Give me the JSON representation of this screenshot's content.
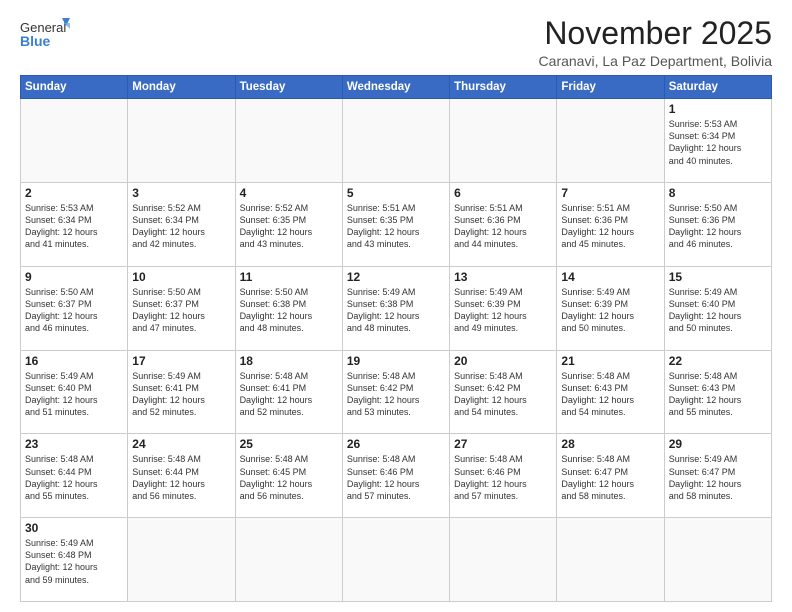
{
  "header": {
    "logo_general": "General",
    "logo_blue": "Blue",
    "title": "November 2025",
    "subtitle": "Caranavi, La Paz Department, Bolivia"
  },
  "weekdays": [
    "Sunday",
    "Monday",
    "Tuesday",
    "Wednesday",
    "Thursday",
    "Friday",
    "Saturday"
  ],
  "weeks": [
    [
      {
        "day": "",
        "text": ""
      },
      {
        "day": "",
        "text": ""
      },
      {
        "day": "",
        "text": ""
      },
      {
        "day": "",
        "text": ""
      },
      {
        "day": "",
        "text": ""
      },
      {
        "day": "",
        "text": ""
      },
      {
        "day": "1",
        "text": "Sunrise: 5:53 AM\nSunset: 6:34 PM\nDaylight: 12 hours\nand 40 minutes."
      }
    ],
    [
      {
        "day": "2",
        "text": "Sunrise: 5:53 AM\nSunset: 6:34 PM\nDaylight: 12 hours\nand 41 minutes."
      },
      {
        "day": "3",
        "text": "Sunrise: 5:52 AM\nSunset: 6:34 PM\nDaylight: 12 hours\nand 42 minutes."
      },
      {
        "day": "4",
        "text": "Sunrise: 5:52 AM\nSunset: 6:35 PM\nDaylight: 12 hours\nand 43 minutes."
      },
      {
        "day": "5",
        "text": "Sunrise: 5:51 AM\nSunset: 6:35 PM\nDaylight: 12 hours\nand 43 minutes."
      },
      {
        "day": "6",
        "text": "Sunrise: 5:51 AM\nSunset: 6:36 PM\nDaylight: 12 hours\nand 44 minutes."
      },
      {
        "day": "7",
        "text": "Sunrise: 5:51 AM\nSunset: 6:36 PM\nDaylight: 12 hours\nand 45 minutes."
      },
      {
        "day": "8",
        "text": "Sunrise: 5:50 AM\nSunset: 6:36 PM\nDaylight: 12 hours\nand 46 minutes."
      }
    ],
    [
      {
        "day": "9",
        "text": "Sunrise: 5:50 AM\nSunset: 6:37 PM\nDaylight: 12 hours\nand 46 minutes."
      },
      {
        "day": "10",
        "text": "Sunrise: 5:50 AM\nSunset: 6:37 PM\nDaylight: 12 hours\nand 47 minutes."
      },
      {
        "day": "11",
        "text": "Sunrise: 5:50 AM\nSunset: 6:38 PM\nDaylight: 12 hours\nand 48 minutes."
      },
      {
        "day": "12",
        "text": "Sunrise: 5:49 AM\nSunset: 6:38 PM\nDaylight: 12 hours\nand 48 minutes."
      },
      {
        "day": "13",
        "text": "Sunrise: 5:49 AM\nSunset: 6:39 PM\nDaylight: 12 hours\nand 49 minutes."
      },
      {
        "day": "14",
        "text": "Sunrise: 5:49 AM\nSunset: 6:39 PM\nDaylight: 12 hours\nand 50 minutes."
      },
      {
        "day": "15",
        "text": "Sunrise: 5:49 AM\nSunset: 6:40 PM\nDaylight: 12 hours\nand 50 minutes."
      }
    ],
    [
      {
        "day": "16",
        "text": "Sunrise: 5:49 AM\nSunset: 6:40 PM\nDaylight: 12 hours\nand 51 minutes."
      },
      {
        "day": "17",
        "text": "Sunrise: 5:49 AM\nSunset: 6:41 PM\nDaylight: 12 hours\nand 52 minutes."
      },
      {
        "day": "18",
        "text": "Sunrise: 5:48 AM\nSunset: 6:41 PM\nDaylight: 12 hours\nand 52 minutes."
      },
      {
        "day": "19",
        "text": "Sunrise: 5:48 AM\nSunset: 6:42 PM\nDaylight: 12 hours\nand 53 minutes."
      },
      {
        "day": "20",
        "text": "Sunrise: 5:48 AM\nSunset: 6:42 PM\nDaylight: 12 hours\nand 54 minutes."
      },
      {
        "day": "21",
        "text": "Sunrise: 5:48 AM\nSunset: 6:43 PM\nDaylight: 12 hours\nand 54 minutes."
      },
      {
        "day": "22",
        "text": "Sunrise: 5:48 AM\nSunset: 6:43 PM\nDaylight: 12 hours\nand 55 minutes."
      }
    ],
    [
      {
        "day": "23",
        "text": "Sunrise: 5:48 AM\nSunset: 6:44 PM\nDaylight: 12 hours\nand 55 minutes."
      },
      {
        "day": "24",
        "text": "Sunrise: 5:48 AM\nSunset: 6:44 PM\nDaylight: 12 hours\nand 56 minutes."
      },
      {
        "day": "25",
        "text": "Sunrise: 5:48 AM\nSunset: 6:45 PM\nDaylight: 12 hours\nand 56 minutes."
      },
      {
        "day": "26",
        "text": "Sunrise: 5:48 AM\nSunset: 6:46 PM\nDaylight: 12 hours\nand 57 minutes."
      },
      {
        "day": "27",
        "text": "Sunrise: 5:48 AM\nSunset: 6:46 PM\nDaylight: 12 hours\nand 57 minutes."
      },
      {
        "day": "28",
        "text": "Sunrise: 5:48 AM\nSunset: 6:47 PM\nDaylight: 12 hours\nand 58 minutes."
      },
      {
        "day": "29",
        "text": "Sunrise: 5:49 AM\nSunset: 6:47 PM\nDaylight: 12 hours\nand 58 minutes."
      }
    ],
    [
      {
        "day": "30",
        "text": "Sunrise: 5:49 AM\nSunset: 6:48 PM\nDaylight: 12 hours\nand 59 minutes."
      },
      {
        "day": "",
        "text": ""
      },
      {
        "day": "",
        "text": ""
      },
      {
        "day": "",
        "text": ""
      },
      {
        "day": "",
        "text": ""
      },
      {
        "day": "",
        "text": ""
      },
      {
        "day": "",
        "text": ""
      }
    ]
  ]
}
